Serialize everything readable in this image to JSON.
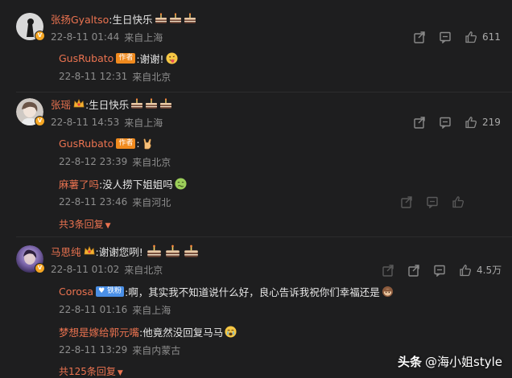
{
  "comments": [
    {
      "author": "张扬Gyaltso",
      "text": ":生日快乐",
      "date": "22-8-11 01:44",
      "location": "来自上海",
      "likes": "611",
      "replies": [
        {
          "author": "GusRubato",
          "badge": "作者",
          "text": ":谢谢!",
          "date": "22-8-11 12:31",
          "location": "来自北京"
        }
      ]
    },
    {
      "author": "张瑶",
      "text": ":生日快乐",
      "date": "22-8-11 14:53",
      "location": "来自上海",
      "likes": "219",
      "replies": [
        {
          "author": "GusRubato",
          "badge": "作者",
          "text": ":",
          "date": "22-8-12 23:39",
          "location": "来自北京"
        },
        {
          "author": "麻薯了吗",
          "text": ":没人捞下姐姐吗",
          "date": "22-8-11 23:46",
          "location": "来自河北"
        }
      ],
      "more_replies": "共3条回复"
    },
    {
      "author": "马思纯",
      "text": ":谢谢您咧!",
      "date": "22-8-11 01:02",
      "location": "来自北京",
      "likes": "4.5万",
      "replies": [
        {
          "author": "Corosa",
          "badge": "铁粉",
          "text": ":啊，其实我不知道说什么好，良心告诉我祝你们幸福还是",
          "date": "22-8-11 01:16",
          "location": "来自上海"
        },
        {
          "author": "梦想是嫁给郭元嘴",
          "text": ":他竟然没回复马马",
          "date": "22-8-11 13:29",
          "location": "来自内蒙古"
        }
      ],
      "more_replies": "共125条回复"
    }
  ],
  "watermark": {
    "brand": "头条",
    "handle": "@海小姐style"
  },
  "colors": {
    "background": "#1e1e1f",
    "name": "#eb7350",
    "meta": "#8d8d8d",
    "author_badge": "#f08a1e"
  }
}
